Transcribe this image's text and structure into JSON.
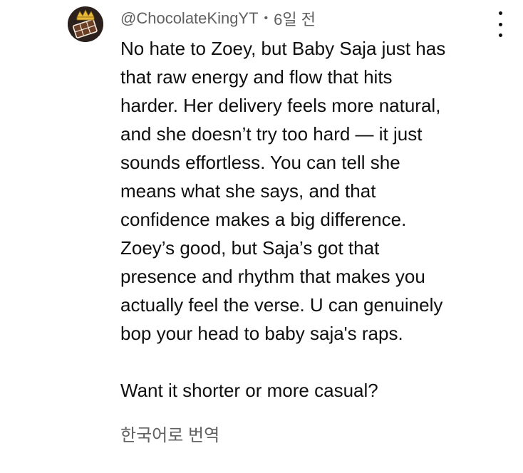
{
  "comment": {
    "author": "@ChocolateKingYT",
    "separator": "•",
    "timestamp": "6일 전",
    "avatar_icon": "chocolate-king-avatar-icon",
    "menu_icon": "more-vertical-icon",
    "lines": [
      "No hate to Zoey, but Baby Saja just has",
      "that raw energy and flow that hits",
      "harder. Her delivery feels more natural,",
      "and she doesn’t try too hard — it just",
      "sounds effortless. You can tell she",
      "means what she says, and that",
      "confidence makes a big difference.",
      "Zoey’s good, but Saja’s got that",
      "presence and rhythm that makes you",
      "actually feel the verse. U can genuinely",
      "bop your head to baby saja's raps."
    ],
    "followup": "Want it shorter or more casual?",
    "translate_label": "한국어로 번역"
  },
  "colors": {
    "text_primary": "#0f0f0f",
    "text_secondary": "#606060",
    "background": "#ffffff"
  }
}
